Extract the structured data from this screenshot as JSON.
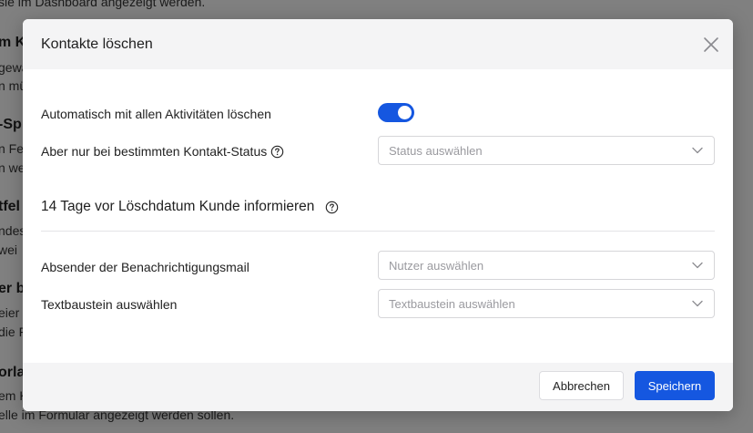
{
  "background": {
    "texts": [
      "sie im Dashboard angezeigt werden.",
      "m K",
      "gewä",
      "n mü",
      "-Sp",
      "n Fe",
      "n we",
      "tfel",
      "ndes",
      " wei",
      "er b",
      "eier",
      "die F",
      "orla",
      "em K",
      "elle im Formular angezeigt werden sollen."
    ]
  },
  "modal": {
    "title": "Kontakte löschen",
    "auto_delete": {
      "label": "Automatisch mit allen Aktivitäten löschen",
      "enabled": true
    },
    "status": {
      "label": "Aber nur bei bestimmten Kontakt-Status",
      "placeholder": "Status auswählen"
    },
    "notify_section": {
      "heading": "14 Tage vor Löschdatum Kunde informieren"
    },
    "sender": {
      "label": "Absender der Benachrichtigungsmail",
      "placeholder": "Nutzer auswählen"
    },
    "template": {
      "label": "Textbaustein auswählen",
      "placeholder": "Textbaustein auswählen"
    },
    "footer": {
      "cancel_label": "Abbrechen",
      "save_label": "Speichern"
    }
  },
  "colors": {
    "primary": "#1557e0",
    "overlay": "#808080",
    "header_bg": "#f4f4f5"
  },
  "icons": [
    "close-icon",
    "help-circle-icon",
    "chevron-down-icon"
  ]
}
